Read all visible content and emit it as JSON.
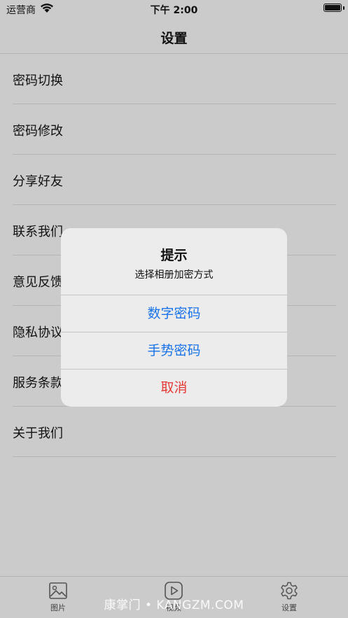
{
  "status_bar": {
    "carrier": "运营商",
    "time": "下午 2:00"
  },
  "nav": {
    "title": "设置"
  },
  "menu": [
    {
      "label": "密码切换"
    },
    {
      "label": "密码修改"
    },
    {
      "label": "分享好友"
    },
    {
      "label": "联系我们"
    },
    {
      "label": "意见反馈"
    },
    {
      "label": "隐私协议"
    },
    {
      "label": "服务条款"
    },
    {
      "label": "关于我们"
    }
  ],
  "alert": {
    "title": "提示",
    "message": "选择相册加密方式",
    "actions": [
      {
        "label": "数字密码",
        "style": "default"
      },
      {
        "label": "手势密码",
        "style": "default"
      },
      {
        "label": "取消",
        "style": "destructive"
      }
    ]
  },
  "tab_bar": {
    "tabs": [
      {
        "label": "图片",
        "icon": "image-icon"
      },
      {
        "label": "视频",
        "icon": "play-icon"
      },
      {
        "label": "设置",
        "icon": "gear-icon"
      }
    ]
  },
  "watermark": "康掌门 • KANGZM.COM",
  "colors": {
    "action_blue": "#1a73e8",
    "action_red": "#e53935",
    "dimmed_background": "#cbcbcb"
  }
}
